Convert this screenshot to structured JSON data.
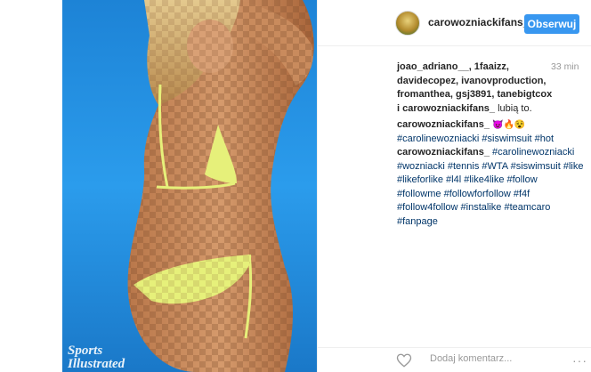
{
  "header": {
    "username": "carowozniackifans_",
    "follow_label": "Obserwuj"
  },
  "photo": {
    "watermark_line1": "Sports",
    "watermark_line2": "Illustrated"
  },
  "likes": {
    "users": "joao_adriano__, 1faaizz, davidecopez, ivanovproduction, fromanthea, gsj3891, tanebigtcox i carowozniackifans_",
    "suffix": " lubią to.",
    "time": "33 min"
  },
  "comments": [
    {
      "user": "carowozniackifans_",
      "emojis": [
        "😈",
        "🔥",
        "😵"
      ],
      "tags": "#carolinewozniacki #siswimsuit #hot"
    },
    {
      "user": "carowozniackifans_",
      "tags": "#carolinewozniacki #wozniacki #tennis #WTA #siswimsuit #like #likeforlike #l4l #like4like #follow #followme #followforfollow #f4f #follow4follow #instalike #teamcaro #fanpage"
    }
  ],
  "footer": {
    "comment_placeholder": "Dodaj komentarz...",
    "more_label": "···"
  },
  "colors": {
    "accent": "#3897f0",
    "hashtag": "#003569",
    "sky": "#2a9aea",
    "bikini": "#e6f07a"
  },
  "icons": {
    "like": "heart-icon",
    "more": "more-options-icon"
  }
}
